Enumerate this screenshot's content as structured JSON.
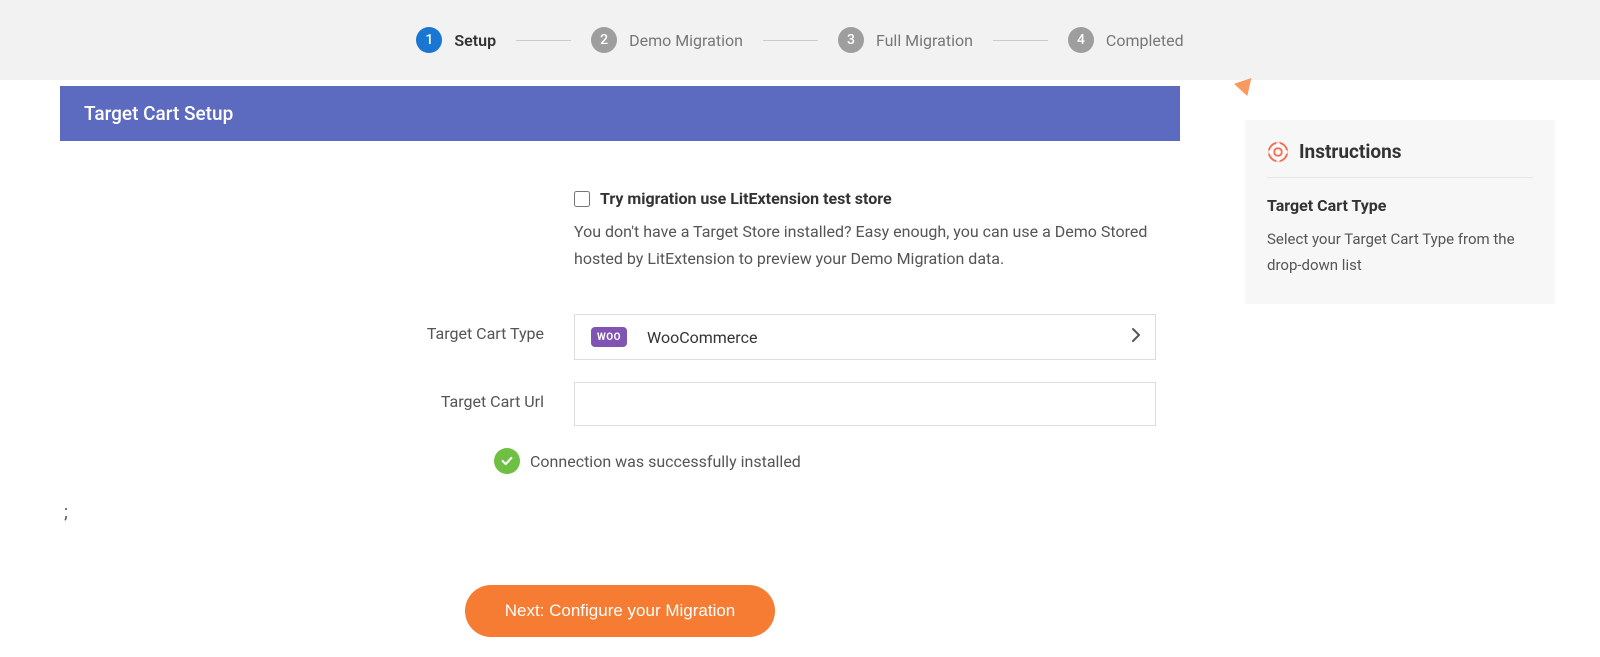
{
  "stepper": {
    "steps": [
      {
        "num": "1",
        "label": "Setup",
        "active": true
      },
      {
        "num": "2",
        "label": "Demo Migration",
        "active": false
      },
      {
        "num": "3",
        "label": "Full Migration",
        "active": false
      },
      {
        "num": "4",
        "label": "Completed",
        "active": false
      }
    ]
  },
  "header": {
    "title": "Target Cart Setup"
  },
  "form": {
    "try_checkbox_label": "Try migration use LitExtension test store",
    "try_desc": "You don't have a Target Store installed? Easy enough, you can use a Demo Stored hosted by LitExtension to preview your Demo Migration data.",
    "cart_type_label": "Target Cart Type",
    "cart_type_value": "WooCommerce",
    "cart_type_logo_text": "WOO",
    "cart_url_label": "Target Cart Url",
    "cart_url_value": "",
    "status_text": "Connection was successfully installed",
    "stray_char": ";",
    "next_button": "Next: Configure your Migration"
  },
  "instructions": {
    "title": "Instructions",
    "subtitle": "Target Cart Type",
    "text": "Select your Target Cart Type from the drop-down list"
  }
}
